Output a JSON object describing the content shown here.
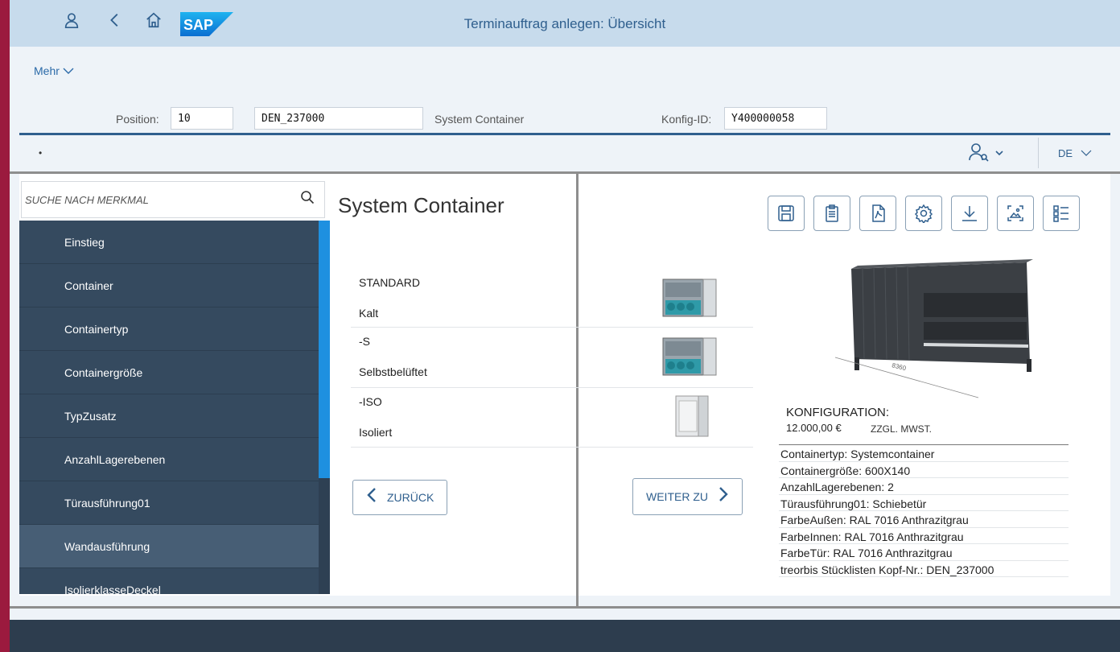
{
  "shell": {
    "title": "Terminauftrag anlegen: Übersicht",
    "logo_text": "SAP"
  },
  "toolbar": {
    "more_label": "Mehr"
  },
  "header": {
    "position_label": "Position:",
    "position_value": "10",
    "material_value": "DEN_237000",
    "material_desc": "System Container",
    "config_id_label": "Konfig-ID:",
    "config_id_value": "Y400000058"
  },
  "config_bar": {
    "dot": "•",
    "language": "DE"
  },
  "sidebar": {
    "search_placeholder": "SUCHE NACH MERKMAL",
    "items": [
      {
        "label": "Einstieg"
      },
      {
        "label": "Container"
      },
      {
        "label": "Containertyp"
      },
      {
        "label": "Containergröße"
      },
      {
        "label": "TypZusatz"
      },
      {
        "label": "AnzahlLagerebenen"
      },
      {
        "label": "Türausführung01"
      },
      {
        "label": "Wandausführung"
      },
      {
        "label": "IsolierklasseDeckel"
      }
    ],
    "active_index": 7
  },
  "main": {
    "title": "System Container",
    "options": [
      {
        "code": "STANDARD",
        "label": "Kalt"
      },
      {
        "code": "-S",
        "label": "Selbstbelüftet"
      },
      {
        "code": "-ISO",
        "label": "Isoliert"
      }
    ],
    "back_label": "ZURÜCK",
    "next_label": "WEITER ZU"
  },
  "right": {
    "toolbar_icons": [
      "save-icon",
      "clipboard-icon",
      "pdf-export-icon",
      "settings-icon",
      "download-icon",
      "image-capture-icon",
      "list-icon"
    ],
    "konfig_label": "KONFIGURATION:",
    "price": "12.000,00 €",
    "tax_note": "ZZGL. MWST.",
    "summary": [
      "Containertyp: Systemcontainer",
      "Containergröße: 600X140",
      "AnzahlLagerebenen: 2",
      "Türausführung01: Schiebetür",
      "FarbeAußen: RAL 7016 Anthrazitgrau",
      "FarbeInnen: RAL 7016 Anthrazitgrau",
      "FarbeTür: RAL 7016 Anthrazitgrau",
      "treorbis Stücklisten Kopf-Nr.: DEN_237000"
    ],
    "dimension_label": "8360"
  },
  "colors": {
    "brand": "#9b1a3e",
    "shell": "#c7dbec",
    "sidebar": "#354a5f",
    "accent": "#1e90e0"
  }
}
